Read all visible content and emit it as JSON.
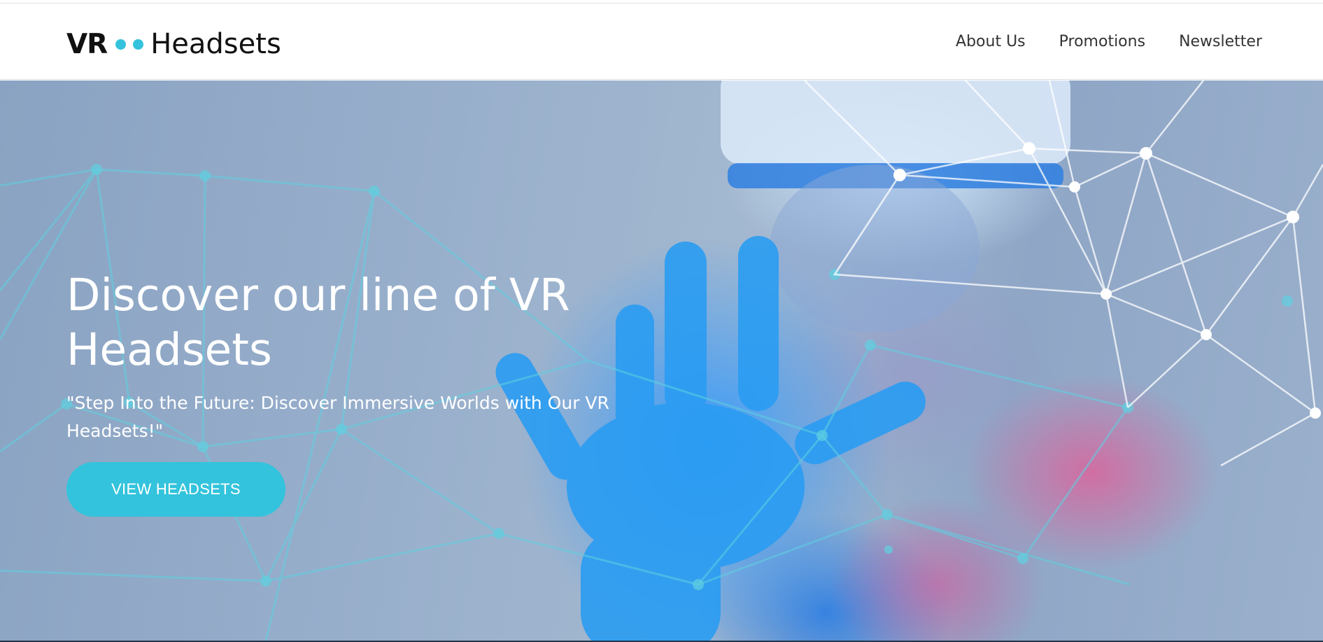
{
  "brand": {
    "prefix": "VR",
    "name": "Headsets",
    "accent_color": "#33c3dc"
  },
  "nav": {
    "items": [
      {
        "label": "About Us"
      },
      {
        "label": "Promotions"
      },
      {
        "label": "Newsletter"
      }
    ]
  },
  "hero": {
    "title": "Discover our line of VR Headsets",
    "subtitle": "\"Step Into the Future: Discover Immersive Worlds with Our VR Headsets!\"",
    "cta_label": "VIEW HEADSETS",
    "image": "person-wearing-vr-headset-reaching-hand-with-network-lines"
  }
}
